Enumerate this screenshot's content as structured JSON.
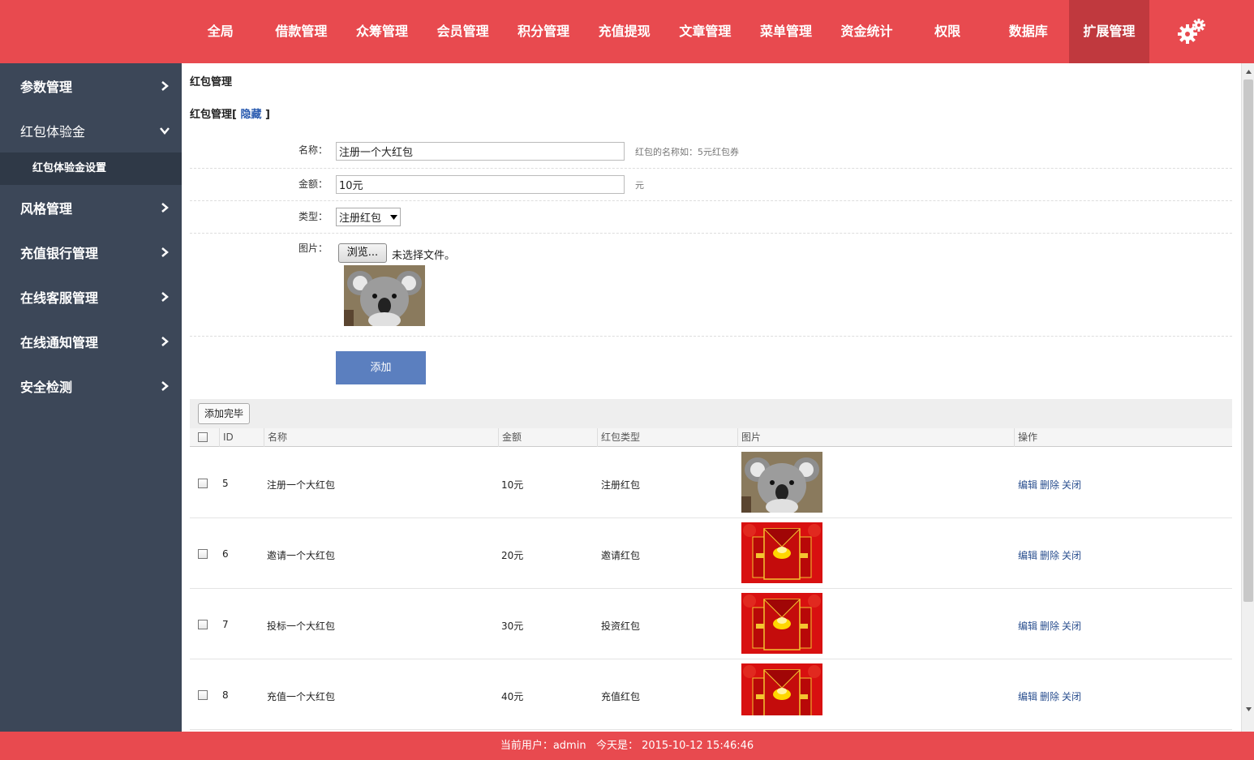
{
  "topnav": {
    "items": [
      "全局",
      "借款管理",
      "众筹管理",
      "会员管理",
      "积分管理",
      "充值提现",
      "文章管理",
      "菜单管理",
      "资金统计",
      "权限",
      "数据库",
      "扩展管理"
    ],
    "active_index": 11,
    "settings_icon": "gear-icon"
  },
  "sidebar": {
    "items": [
      {
        "label": "参数管理",
        "icon": "chevron-right-icon"
      },
      {
        "label": "红包体验金",
        "icon": "chevron-down-icon"
      },
      {
        "label": "风格管理",
        "icon": "chevron-right-icon"
      },
      {
        "label": "充值银行管理",
        "icon": "chevron-right-icon"
      },
      {
        "label": "在线客服管理",
        "icon": "chevron-right-icon"
      },
      {
        "label": "在线通知管理",
        "icon": "chevron-right-icon"
      },
      {
        "label": "安全检测",
        "icon": "chevron-right-icon"
      }
    ],
    "subitem": "红包体验金设置"
  },
  "main": {
    "breadcrumb": "红包管理",
    "section_title": "红包管理[",
    "hide_link": "隐藏",
    "section_title_end": "]",
    "form": {
      "name_label": "名称：",
      "name_value": "注册一个大红包",
      "name_hint": "红包的名称如：5元红包券",
      "amount_label": "金额：",
      "amount_value": "10元",
      "amount_hint": "元",
      "type_label": "类型：",
      "type_value": "注册红包",
      "image_label": "图片：",
      "browse_button": "浏览...",
      "no_file_text": "未选择文件。",
      "submit_button": "添加"
    },
    "toolbar": {
      "done_button": "添加完毕"
    },
    "table": {
      "headers": [
        "ID",
        "名称",
        "金额",
        "红包类型",
        "图片",
        "操作"
      ],
      "rows": [
        {
          "id": "5",
          "name": "注册一个大红包",
          "amount": "10元",
          "type": "注册红包",
          "image": "koala"
        },
        {
          "id": "6",
          "name": "邀请一个大红包",
          "amount": "20元",
          "type": "邀请红包",
          "image": "red-envelope"
        },
        {
          "id": "7",
          "name": "投标一个大红包",
          "amount": "30元",
          "type": "投资红包",
          "image": "red-envelope"
        },
        {
          "id": "8",
          "name": "充值一个大红包",
          "amount": "40元",
          "type": "充值红包",
          "image": "red-envelope"
        }
      ],
      "actions": [
        "编辑",
        "删除",
        "关闭"
      ]
    }
  },
  "footer": {
    "text": "当前用户：admin   今天是： 2015-10-12 15:46:46"
  },
  "colors": {
    "brand_red": "#e84a4f",
    "active_nav": "#c0393e",
    "sidebar_bg": "#3c4758",
    "button_blue": "#5b7fbf",
    "link_blue": "#2a5bb0"
  }
}
